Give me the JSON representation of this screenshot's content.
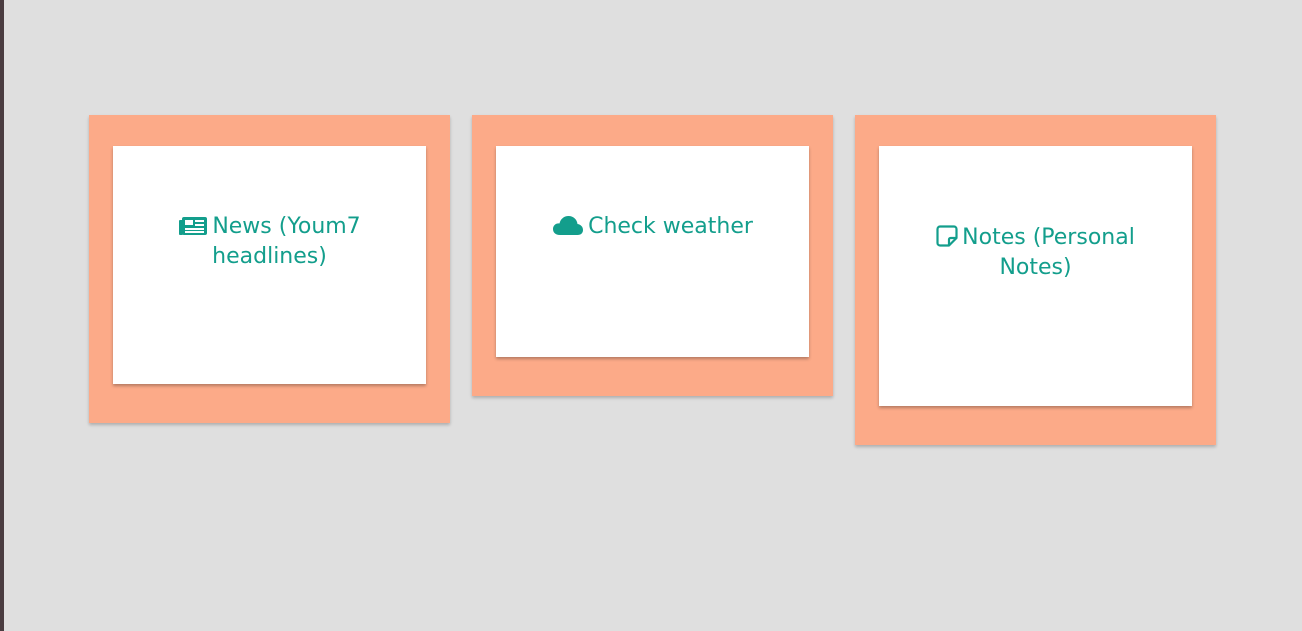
{
  "colors": {
    "background": "#dfdfdf",
    "card_outer": "#fcaa88",
    "card_inner": "#ffffff",
    "accent": "#139e8c"
  },
  "cards": [
    {
      "label": "News (Youm7 headlines)",
      "icon": "newspaper-icon"
    },
    {
      "label": "Check weather",
      "icon": "cloud-icon"
    },
    {
      "label": "Notes (Personal Notes)",
      "icon": "sticky-note-icon"
    }
  ]
}
